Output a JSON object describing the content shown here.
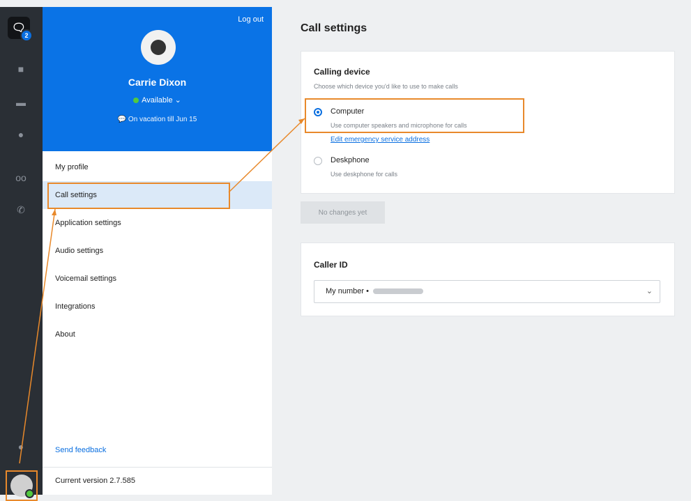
{
  "rail": {
    "badge_count": "2",
    "icons": [
      "chat-icon",
      "video-icon",
      "folder-icon",
      "clock-icon",
      "voicemail-icon",
      "phone-icon",
      "dots-icon"
    ]
  },
  "profile": {
    "logout": "Log out",
    "name": "Carrie Dixon",
    "status": "Available ⌄",
    "vacation": "💬 On vacation till Jun 15"
  },
  "menu": {
    "items": [
      "My profile",
      "Call settings",
      "Application settings",
      "Audio settings",
      "Voicemail settings",
      "Integrations",
      "About"
    ],
    "feedback": "Send feedback",
    "version": "Current version 2.7.585"
  },
  "main": {
    "title": "Call settings",
    "calling_device": {
      "title": "Calling device",
      "subtitle": "Choose which device you'd like to use to make calls",
      "options": [
        {
          "label": "Computer",
          "desc": "Use computer speakers and microphone for calls",
          "selected": true
        },
        {
          "label": "Deskphone",
          "desc": "Use deskphone for calls",
          "selected": false
        }
      ],
      "link": "Edit emergency service address"
    },
    "button": "No changes yet",
    "caller_id": {
      "title": "Caller ID",
      "value": "My number •"
    }
  },
  "colors": {
    "accent": "#0a73e6",
    "highlight": "#e8892b"
  }
}
